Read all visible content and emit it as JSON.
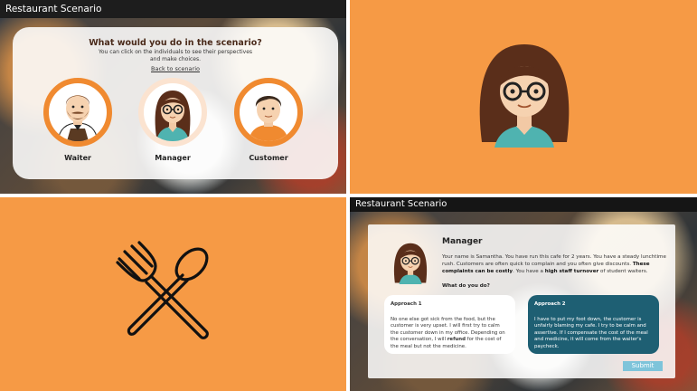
{
  "panel1": {
    "app_title": "Restaurant Scenario",
    "question": "What would you do in the scenario?",
    "subtitle": "You can click on the individuals to see their perspectives and make choices.",
    "back_link": "Back to scenario",
    "people": [
      {
        "label": "Waiter",
        "icon": "waiter-avatar"
      },
      {
        "label": "Manager",
        "icon": "manager-avatar"
      },
      {
        "label": "Customer",
        "icon": "customer-avatar"
      }
    ]
  },
  "panel2": {
    "icon": "manager-avatar",
    "background": "#f69a45"
  },
  "panel3": {
    "icon": "fork-spoon-icon",
    "background": "#f69a45"
  },
  "panel4": {
    "app_title": "Restaurant Scenario",
    "heading": "Manager",
    "intro_1": "Your name is Samantha. You have run this cafe for 2 years. You have a steady lunchtime rush. Customers are often quick to complain and you often give discounts. ",
    "intro_bold_1": "These complaints can be costly",
    "intro_2": ". You have a ",
    "intro_bold_2": "high staff  turnover",
    "intro_3": " of student waiters.",
    "question": "What do you do?",
    "approach1": {
      "title": "Approach 1",
      "text_1": "No one else got sick from the food, but the customer is very upset. I will first try to calm the customer down in my office. Depending on the conversation, I will ",
      "text_bold": "refund",
      "text_2": " for the cost of the meal but not the medicine."
    },
    "approach2": {
      "title": "Approach 2",
      "text": "I have to put my foot down, the customer is unfairly blaming my cafe. I try to be calm and assertive. If I compensate the cost of the meal and medicine, it will come from the waiter's paycheck."
    },
    "submit_label": "Submit"
  },
  "colors": {
    "accent_orange": "#f69a45",
    "ring_orange": "#f08a30",
    "teal": "#1e5f73",
    "submit": "#7ec4da"
  }
}
